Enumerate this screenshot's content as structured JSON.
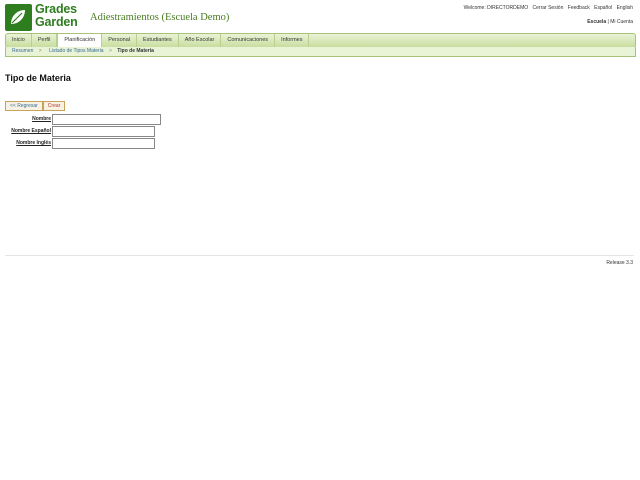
{
  "logo": {
    "line1": "Grades",
    "line2": "Garden"
  },
  "school_name": "Adiestramientos (Escuela Demo)",
  "top_links": {
    "welcome": "Welcome: DIRECTORDEMO",
    "logout": "Cerrar Sesión",
    "feedback": "Feedback",
    "spanish": "Español",
    "english": "English"
  },
  "account": {
    "school": "Escuela",
    "separator": "|",
    "my_account": "Mi Cuenta"
  },
  "menu": [
    {
      "label": "Inicio"
    },
    {
      "label": "Perfil"
    },
    {
      "label": "Planificación"
    },
    {
      "label": "Personal"
    },
    {
      "label": "Estudiantes"
    },
    {
      "label": "Año Escolar"
    },
    {
      "label": "Comunicaciones"
    },
    {
      "label": "Informes"
    }
  ],
  "breadcrumb": {
    "home": "Resumen",
    "list": "Listado de Tipos Materia",
    "current": "Tipo de Materia",
    "sep": ">"
  },
  "page_title": "Tipo de Materia",
  "buttons": {
    "back": "<< Regresar",
    "create": "Crear"
  },
  "form": {
    "name_label": "Nombre",
    "name_es_label": "Nombre Español",
    "name_en_label": "Nombre Inglés"
  },
  "release": "Release 3.3",
  "colors": {
    "brand_green": "#2e7d1f",
    "menu_bg": "#c8dea0"
  }
}
